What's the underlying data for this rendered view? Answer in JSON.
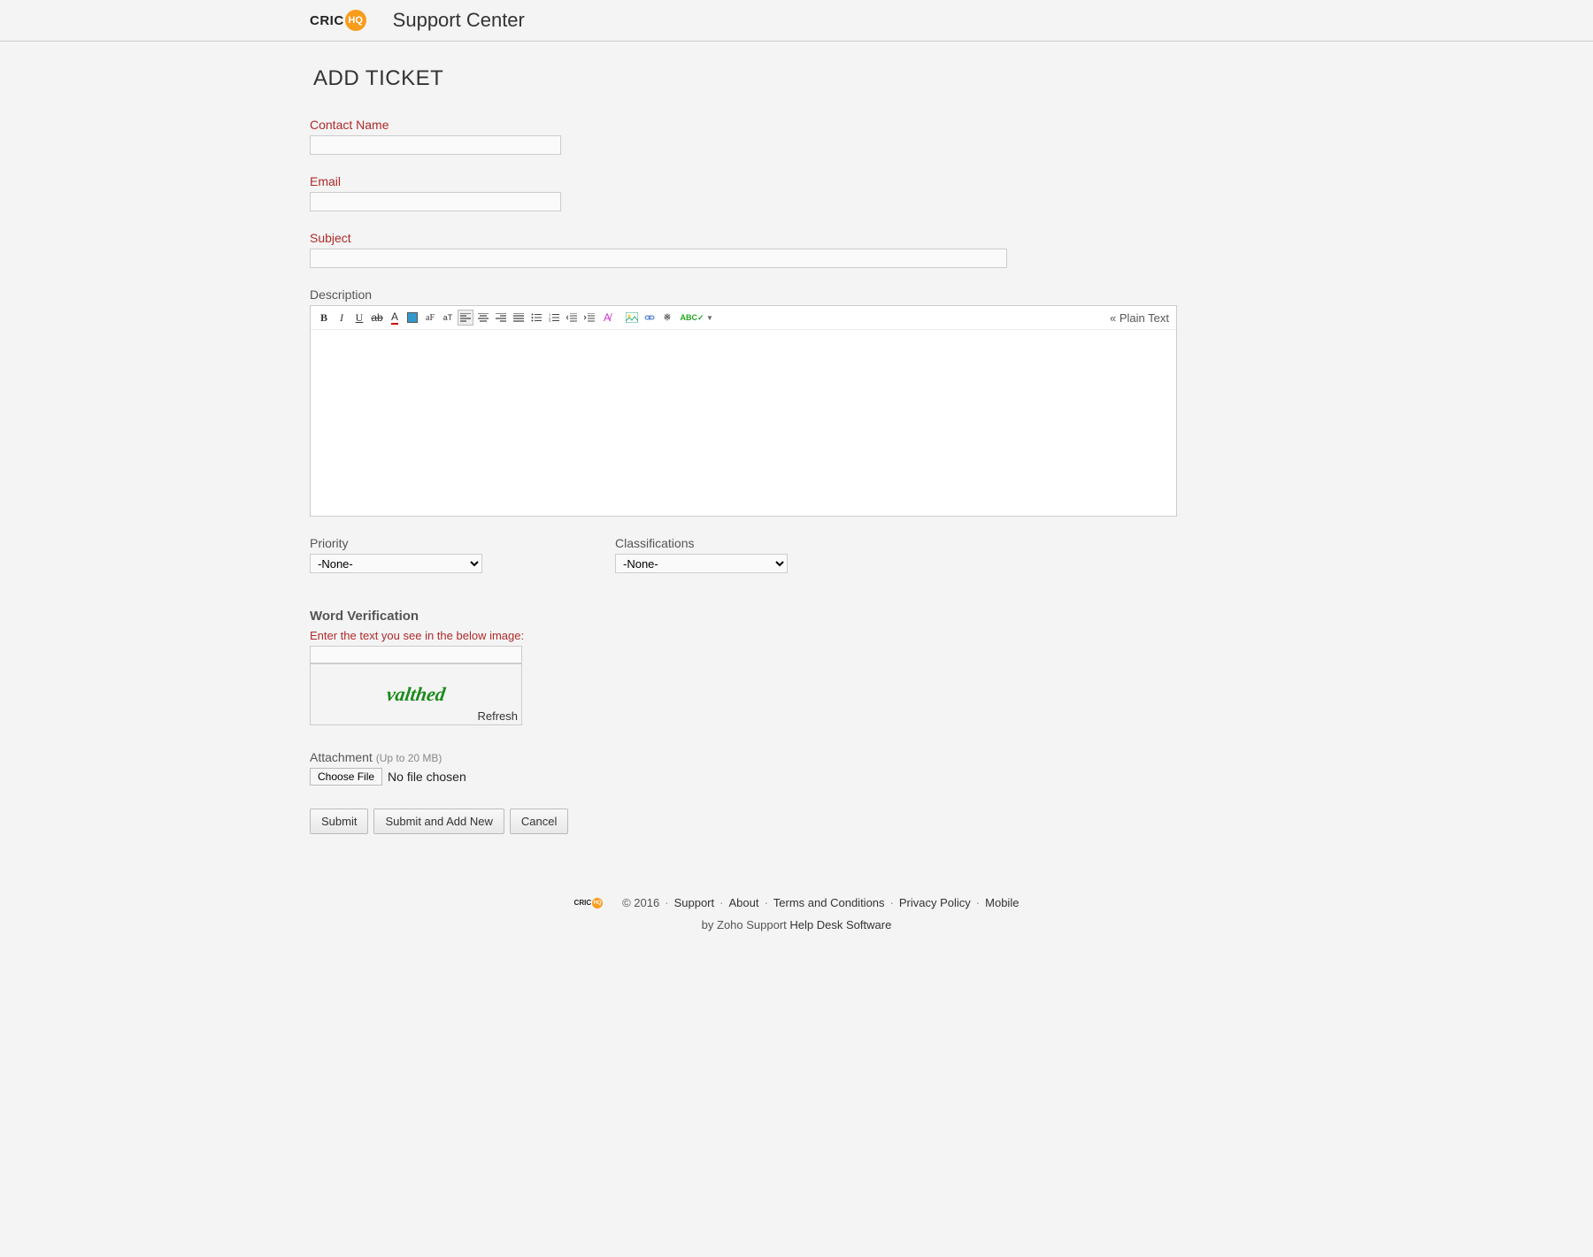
{
  "header": {
    "logo_prefix": "CRIC",
    "logo_suffix": "HQ",
    "title": "Support Center"
  },
  "page": {
    "title": "ADD TICKET"
  },
  "form": {
    "contact_name": {
      "label": "Contact Name",
      "value": ""
    },
    "email": {
      "label": "Email",
      "value": ""
    },
    "subject": {
      "label": "Subject",
      "value": ""
    },
    "description": {
      "label": "Description",
      "plain_text_link": "« Plain Text"
    },
    "priority": {
      "label": "Priority",
      "selected": "-None-"
    },
    "classifications": {
      "label": "Classifications",
      "selected": "-None-"
    },
    "word_verification": {
      "section_title": "Word Verification",
      "prompt": "Enter the text you see in the below image:",
      "captcha_value": "valthed",
      "refresh": "Refresh"
    },
    "attachment": {
      "label": "Attachment",
      "hint": "(Up to 20 MB)",
      "choose_label": "Choose File",
      "no_file": "No file chosen"
    },
    "buttons": {
      "submit": "Submit",
      "submit_add_new": "Submit and Add New",
      "cancel": "Cancel"
    }
  },
  "footer": {
    "copyright": "© 2016",
    "links": {
      "support": "Support",
      "about": "About",
      "terms": "Terms and Conditions",
      "privacy": "Privacy Policy",
      "mobile": "Mobile"
    },
    "by_prefix": "by Zoho Support",
    "by_link": "Help Desk Software"
  }
}
